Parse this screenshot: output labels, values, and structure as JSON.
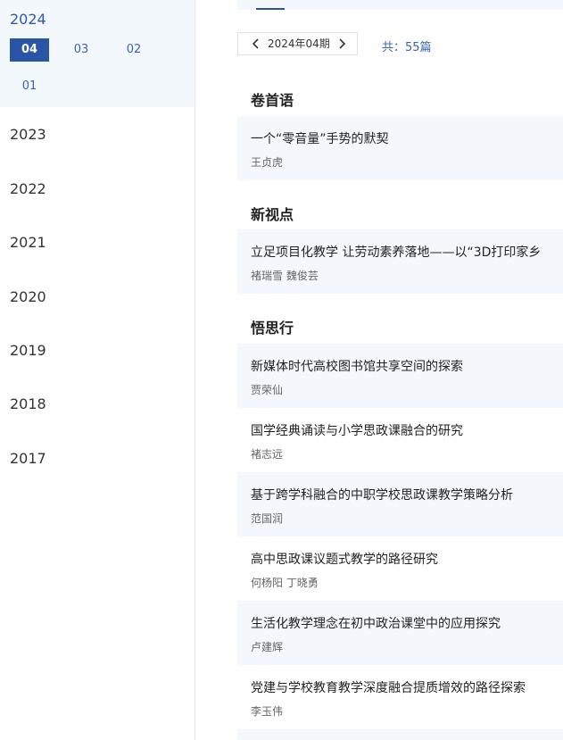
{
  "sidebar": {
    "active_year": "2024",
    "months": [
      "04",
      "03",
      "02",
      "01"
    ],
    "active_month": "04",
    "years": [
      "2023",
      "2022",
      "2021",
      "2020",
      "2019",
      "2018",
      "2017"
    ]
  },
  "issue": {
    "label": "2024年04期",
    "prev_icon": "chevron-left-icon",
    "next_icon": "chevron-right-icon",
    "total": "共：55篇"
  },
  "sections": [
    {
      "title": "卷首语",
      "articles": [
        {
          "title": "一个“零音量”手势的默契",
          "authors": "王贞虎"
        }
      ]
    },
    {
      "title": "新视点",
      "articles": [
        {
          "title": "立足项目化教学 让劳动素养落地——以“3D打印家乡",
          "authors": "褚瑞雪 魏俊芸"
        }
      ]
    },
    {
      "title": "悟思行",
      "articles": [
        {
          "title": "新媒体时代高校图书馆共享空间的探索",
          "authors": "贾荣仙"
        },
        {
          "title": "国学经典诵读与小学思政课融合的研究",
          "authors": "褚志远"
        },
        {
          "title": "基于跨学科融合的中职学校思政课教学策略分析",
          "authors": "范国润"
        },
        {
          "title": "高中思政课议题式教学的路径研究",
          "authors": "何杨阳 丁晓勇"
        },
        {
          "title": "生活化教学理念在初中政治课堂中的应用探究",
          "authors": "卢建辉"
        },
        {
          "title": "党建与学校教育教学深度融合提质增效的路径探索",
          "authors": "李玉伟"
        }
      ]
    }
  ],
  "colors": {
    "accent": "#2a55a6",
    "link": "#3a64b0",
    "card_bg": "#f4f8fc"
  }
}
